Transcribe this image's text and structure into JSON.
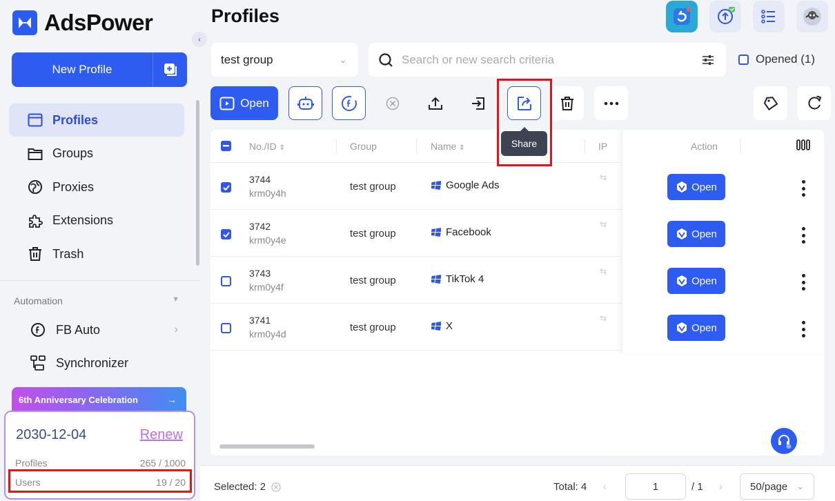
{
  "app": {
    "brand": "AdsPower",
    "page_title": "Profiles"
  },
  "sidebar": {
    "new_profile_label": "New Profile",
    "nav_items": [
      {
        "label": "Profiles",
        "icon": "profiles-icon",
        "active": true
      },
      {
        "label": "Groups",
        "icon": "folder-icon",
        "active": false
      },
      {
        "label": "Proxies",
        "icon": "proxy-icon",
        "active": false
      },
      {
        "label": "Extensions",
        "icon": "puzzle-icon",
        "active": false
      },
      {
        "label": "Trash",
        "icon": "trash-icon",
        "active": false
      }
    ],
    "automation_heading": "Automation",
    "automation_items": [
      {
        "label": "FB Auto",
        "icon": "facebook-auto-icon"
      },
      {
        "label": "Synchronizer",
        "icon": "synchronizer-icon"
      }
    ],
    "banner": "6th Anniversary Celebration",
    "plan": {
      "expiry": "2030-12-04",
      "renew_label": "Renew",
      "profiles_label": "Profiles",
      "profiles_value": "265 / 1000",
      "users_label": "Users",
      "users_value": "19 / 20"
    }
  },
  "filters": {
    "group_value": "test group",
    "search_placeholder": "Search or new search criteria",
    "opened_label": "Opened (1)"
  },
  "toolbar": {
    "open_label": "Open",
    "share_tooltip": "Share"
  },
  "table": {
    "headers": {
      "no_id": "No./ID",
      "group": "Group",
      "name": "Name",
      "ip": "IP",
      "action": "Action"
    },
    "open_button_label": "Open",
    "rows": [
      {
        "no": "3744",
        "id": "krm0y4h",
        "group": "test group",
        "name": "Google Ads",
        "checked": true
      },
      {
        "no": "3742",
        "id": "krm0y4e",
        "group": "test group",
        "name": "Facebook",
        "checked": true
      },
      {
        "no": "3743",
        "id": "krm0y4f",
        "group": "test group",
        "name": "TikTok 4",
        "checked": false
      },
      {
        "no": "3741",
        "id": "krm0y4d",
        "group": "test group",
        "name": "X",
        "checked": false
      }
    ]
  },
  "footer": {
    "selected_label": "Selected: 2",
    "total_label": "Total: 4",
    "page_value": "1",
    "page_of": "/ 1",
    "per_page": "50/page"
  },
  "colors": {
    "accent": "#2f5cf0",
    "highlight": "#e0161b",
    "sidebar_active_bg": "#dfe4f6"
  }
}
